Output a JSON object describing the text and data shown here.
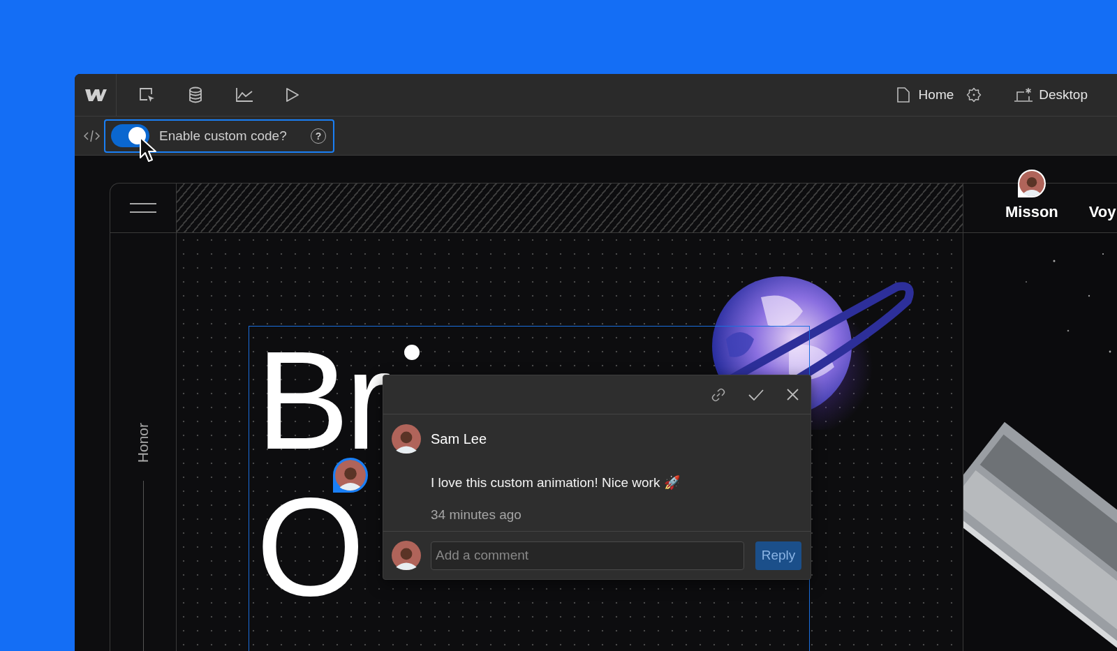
{
  "toolbar": {
    "page": {
      "label": "Home"
    },
    "breakpoint": {
      "label": "Desktop"
    }
  },
  "custom_code": {
    "label": "Enable custom code?",
    "on": true,
    "help": "?"
  },
  "site": {
    "side_label": "Honor",
    "nav_links": [
      "Misson",
      "Voy"
    ],
    "heading_lines": [
      "Br",
      "O"
    ]
  },
  "comment": {
    "author": "Sam Lee",
    "message": "I love this custom animation! Nice work 🚀",
    "time": "34 minutes ago",
    "reply_field": {
      "placeholder": "Add a comment"
    },
    "reply_button": "Reply"
  }
}
